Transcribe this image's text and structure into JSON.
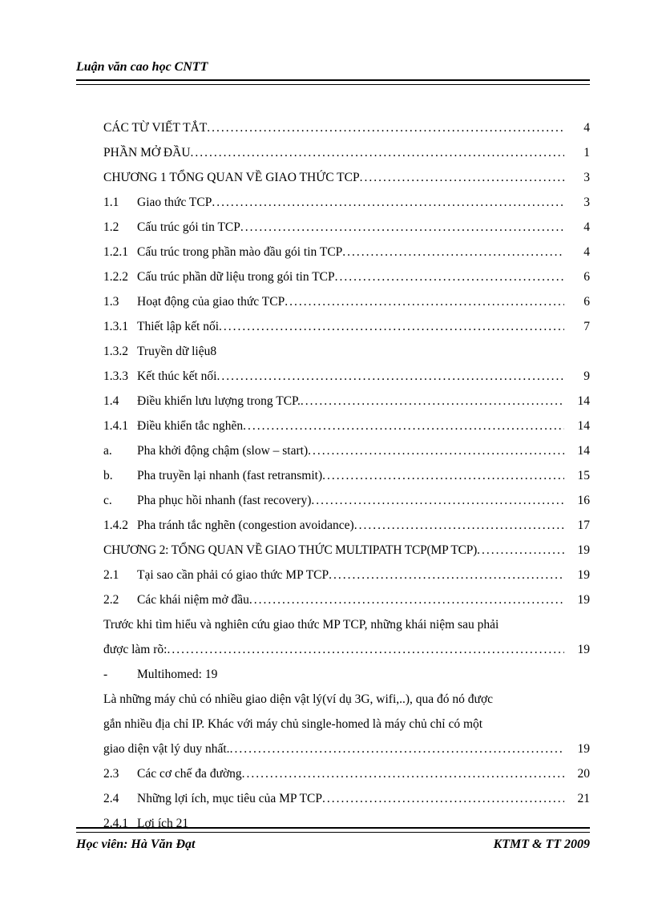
{
  "header": {
    "title": "Luận văn cao học CNTT"
  },
  "footer": {
    "left": "Học viên: Hà Văn Đạt",
    "right": "KTMT & TT 2009"
  },
  "toc": [
    {
      "num": "",
      "title": "CÁC TỪ VIẾT TẮT",
      "page": "4",
      "dots": true
    },
    {
      "num": "",
      "title": "PHẦN MỞ ĐẦU",
      "page": "1",
      "dots": true
    },
    {
      "num": "",
      "title": "CHƯƠNG 1 TỔNG QUAN VỀ GIAO THỨC TCP",
      "page": "3",
      "dots": true
    },
    {
      "num": "1.1",
      "title": "Giao thức TCP",
      "page": "3",
      "dots": true
    },
    {
      "num": "1.2",
      "title": "Cấu trúc gói tin TCP",
      "page": "4",
      "dots": true
    },
    {
      "num": "1.2.1",
      "title": "Cấu trúc trong phần mào đầu gói tin TCP",
      "page": "4",
      "dots": true
    },
    {
      "num": "1.2.2",
      "title": "Cấu trúc phần dữ liệu trong gói tin TCP",
      "page": "6",
      "dots": true
    },
    {
      "num": "1.3",
      "title": "Hoạt động của giao thức TCP",
      "page": "6",
      "dots": true
    },
    {
      "num": "1.3.1",
      "title": "Thiết lập kết nối",
      "page": "7",
      "dots": true
    },
    {
      "num": "1.3.2",
      "title": "Truyền dữ liệu8",
      "page": "",
      "dots": false
    },
    {
      "num": "1.3.3",
      "title": "Kết thúc kết nối",
      "page": "9",
      "dots": true
    },
    {
      "num": "1.4",
      "title": "Điều khiển lưu lượng trong TCP.",
      "page": "14",
      "dots": true
    },
    {
      "num": "1.4.1",
      "title": "Điều khiển tắc nghẽn",
      "page": "14",
      "dots": true
    },
    {
      "num": "a.",
      "title": "Pha khởi động chậm (slow – start)",
      "page": "14",
      "dots": true
    },
    {
      "num": "b.",
      "title": "Pha truyền lại nhanh (fast retransmit)",
      "page": "15",
      "dots": true
    },
    {
      "num": "c.",
      "title": "Pha phục hồi nhanh (fast recovery)",
      "page": "16",
      "dots": true
    },
    {
      "num": "1.4.2",
      "title": "Pha tránh tắc nghẽn (congestion avoidance)",
      "page": "17",
      "dots": true
    },
    {
      "num": "",
      "title": "CHƯƠNG 2: TỔNG QUAN VỀ GIAO THỨC MULTIPATH TCP(MP TCP)",
      "page": "19",
      "dots": true,
      "tight": true
    },
    {
      "num": "2.1",
      "title": "Tại sao cần phải có giao thức MP TCP",
      "page": "19",
      "dots": true
    },
    {
      "num": "2.2",
      "title": "Các khái niệm mở đầu",
      "page": "19",
      "dots": true
    }
  ],
  "para1_pre": "Trước khi tìm hiểu và nghiên cứu giao thức MP TCP, những khái niệm sau phải",
  "para1_last": {
    "text": "được làm rõ:",
    "page": "19"
  },
  "multihomed": {
    "num": "-",
    "title": "Multihomed:   19"
  },
  "para2_lines": [
    "Là những máy chủ có nhiều giao diện vật lý(ví dụ 3G, wifi,..), qua đó nó được",
    "gắn nhiều địa chỉ IP. Khác với máy chủ single-homed là máy chủ chỉ có một"
  ],
  "para2_last": {
    "text": "giao diện vật lý duy nhất.",
    "page": "19"
  },
  "toc_tail": [
    {
      "num": "2.3",
      "title": "Các cơ chế đa đường",
      "page": "20",
      "dots": true
    },
    {
      "num": "2.4",
      "title": "Những lợi ích, mục tiêu của MP TCP",
      "page": "21",
      "dots": true
    },
    {
      "num": "2.4.1",
      "title": "Lợi ích   21",
      "page": "",
      "dots": false
    }
  ]
}
